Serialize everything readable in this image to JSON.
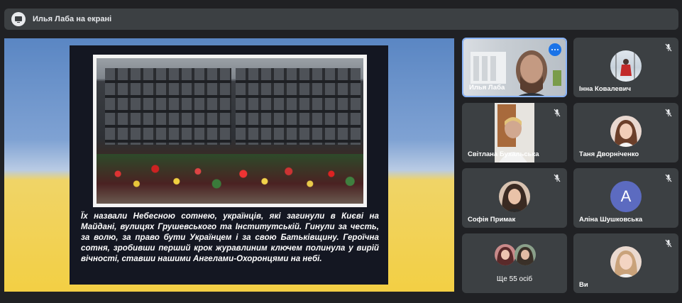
{
  "header": {
    "title": "Илья Лаба на екрані"
  },
  "slide": {
    "caption": "Їх назвали Небесною сотнею, українців, які загинули в Києві на Майдані, вулицях Грушевського та Інститутській. Гинули за честь, за волю, за право бути Українцем і за свою Батьківщину. Героїчна сотня, зробивши перший крок журавлиним ключем полинула у вирій вічності, ставши нашими Ангелами-Охоронцями на небі."
  },
  "participants": [
    {
      "name": "Илья Лаба",
      "muted": false,
      "active": true
    },
    {
      "name": "Інна Ковалевич",
      "muted": true
    },
    {
      "name": "Світлана Бухальська",
      "muted": true
    },
    {
      "name": "Таня Дворніченко",
      "muted": true
    },
    {
      "name": "Софія Примак",
      "muted": true
    },
    {
      "name": "Аліна Шушковська",
      "muted": true,
      "initial": "A"
    },
    {
      "name": "Ще 55 осіб"
    },
    {
      "name": "Ви",
      "muted": true
    }
  ],
  "colors": {
    "accent": "#1a73e8",
    "tile_bg": "#3c4043",
    "page_bg": "#202124"
  }
}
